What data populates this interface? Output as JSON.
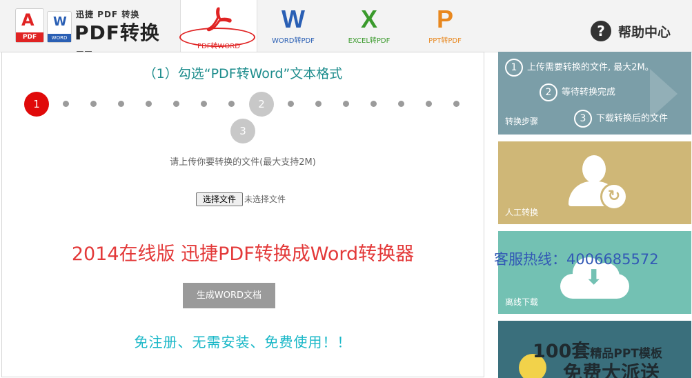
{
  "header": {
    "logo_small": "迅捷 PDF 转换",
    "logo_big": "PDF转换器",
    "logo_pdf_tag": "PDF",
    "logo_word_tag": "WORD",
    "logo_word_letter": "W",
    "tabs": [
      {
        "glyph": "",
        "label": "PDF转WORD",
        "color": "#e02323",
        "active": true
      },
      {
        "glyph": "W",
        "label": "WORD转PDF",
        "color": "#2a5fb4",
        "active": false
      },
      {
        "glyph": "X",
        "label": "EXCEL转PDF",
        "color": "#3a9a2c",
        "active": false
      },
      {
        "glyph": "P",
        "label": "PPT转PDF",
        "color": "#e8871e",
        "active": false
      }
    ],
    "help_icon": "?",
    "help_label": "帮助中心"
  },
  "main": {
    "step_title": "（1）勾选“PDF转Word”文本格式",
    "steps": [
      {
        "number": "1",
        "state": "active"
      },
      {
        "number": "2",
        "state": "idle"
      },
      {
        "number": "3",
        "state": "idle"
      }
    ],
    "upload_hint": "请上传你要转换的文件(最大支持2M)",
    "file_button": "选择文件",
    "file_status": "未选择文件",
    "headline": "2014在线版  迅捷PDF转换成Word转换器",
    "generate_button": "生成WORD文档",
    "free_text": "免注册、无需安装、免费使用！！"
  },
  "hotline": "客服热线：4006685572",
  "sidebar": {
    "steps_panel": {
      "label": "转换步骤",
      "lines": [
        {
          "num": "1",
          "text": "上传需要转换的文件, 最大2M。"
        },
        {
          "num": "2",
          "text": "等待转换完成"
        },
        {
          "num": "3",
          "text": "下载转换后的文件"
        }
      ]
    },
    "manual_panel": {
      "label": "人工转换",
      "icon": "user-refresh-icon"
    },
    "offline_panel": {
      "label": "离线下载",
      "icon": "cloud-download-icon"
    },
    "promo_panel": {
      "count": "100套",
      "subtitle": "精品PPT模板",
      "tagline": "免费大派送"
    }
  }
}
